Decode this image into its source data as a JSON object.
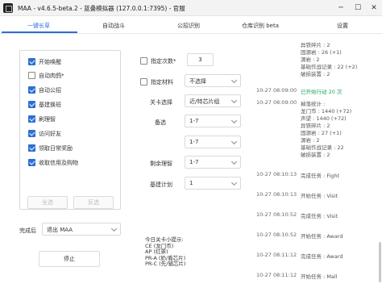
{
  "window": {
    "title": "MAA - v4.6.5-beta.2 - 蓝叠模拟器 (127.0.0.1:7395) - 官服",
    "minimize": "─",
    "maximize": "☐",
    "close": "✕"
  },
  "tabs": [
    "一键长草",
    "自动战斗",
    "公招识别",
    "仓库识别 beta",
    "设置"
  ],
  "tasks": [
    {
      "label": "开始唤醒",
      "checked": true
    },
    {
      "label": "自动肉鸽*",
      "checked": false
    },
    {
      "label": "自动公招",
      "checked": true
    },
    {
      "label": "基建换班",
      "checked": true
    },
    {
      "label": "刷理智",
      "checked": true
    },
    {
      "label": "访问好友",
      "checked": true
    },
    {
      "label": "领取日常奖励",
      "checked": true
    },
    {
      "label": "收取信用及购物",
      "checked": true
    }
  ],
  "buttons": {
    "select_all": "全选",
    "invert": "反选",
    "stop": "停止"
  },
  "completion": {
    "label": "完成后",
    "value": "退出 MAA"
  },
  "settings": {
    "specify_count_label": "指定次数*",
    "specify_count_value": "3",
    "specify_material_label": "指定材料",
    "specify_material_value": "不选择",
    "stage_label": "关卡选择",
    "stage_value": "近/特芯片组",
    "alt_label": "备选",
    "alt1_value": "1-7",
    "alt2_value": "1-7",
    "remaining_label": "剩余理智",
    "remaining_value": "1-7",
    "base_plan_label": "基建计划",
    "base_plan_value": "1"
  },
  "tips": {
    "header": "今日关卡小提示:",
    "lines": [
      "CE (龙门币)",
      "AP (红票)",
      "PR-A (奶/盾芯片)",
      "PR-C (先/辅芯片)"
    ]
  },
  "log": [
    {
      "kind": "stat",
      "text": "异铁碎片 : 2"
    },
    {
      "kind": "stat",
      "text": "固源岩 : 26 (+1)"
    },
    {
      "kind": "stat",
      "text": "源岩 : 2"
    },
    {
      "kind": "stat",
      "text": "基础作战记录 : 22 (+2)"
    },
    {
      "kind": "stat",
      "text": "破损装置 : 2"
    },
    {
      "kind": "entry",
      "time": "10-27  08:09:00",
      "text": "已开始行动 20 次",
      "green": true
    },
    {
      "kind": "entry",
      "time": "10-27  08:09:00",
      "text": "掉落统计 :",
      "green": false
    },
    {
      "kind": "stat",
      "text": "龙门币 : 1440 (+72)"
    },
    {
      "kind": "stat",
      "text": "声望 : 1440 (+72)"
    },
    {
      "kind": "stat",
      "text": "异铁碎片 : 2"
    },
    {
      "kind": "stat",
      "text": "固源岩 : 27 (+1)"
    },
    {
      "kind": "stat",
      "text": "源岩 : 2"
    },
    {
      "kind": "stat",
      "text": "基础作战记录 : 22"
    },
    {
      "kind": "stat",
      "text": "破损装置 : 2"
    },
    {
      "kind": "entry",
      "time": "10-27  08:10:13",
      "text": "完成任务 : Fight",
      "green": false
    },
    {
      "kind": "entry",
      "time": "10-27  08:10:13",
      "text": "开始任务 : Visit",
      "green": false
    },
    {
      "kind": "entry",
      "time": "10-27  08:10:52",
      "text": "完成任务 : Visit",
      "green": false
    },
    {
      "kind": "entry",
      "time": "10-27  08:10:52",
      "text": "开始任务 : Award",
      "green": false
    },
    {
      "kind": "entry",
      "time": "10-27  08:11:12",
      "text": "完成任务 : Award",
      "green": false
    },
    {
      "kind": "entry",
      "time": "10-27  08:11:12",
      "text": "开始任务 : Mall",
      "green": false
    }
  ],
  "colors": {
    "accent": "#2d6fd6",
    "success": "#1fa35a"
  }
}
